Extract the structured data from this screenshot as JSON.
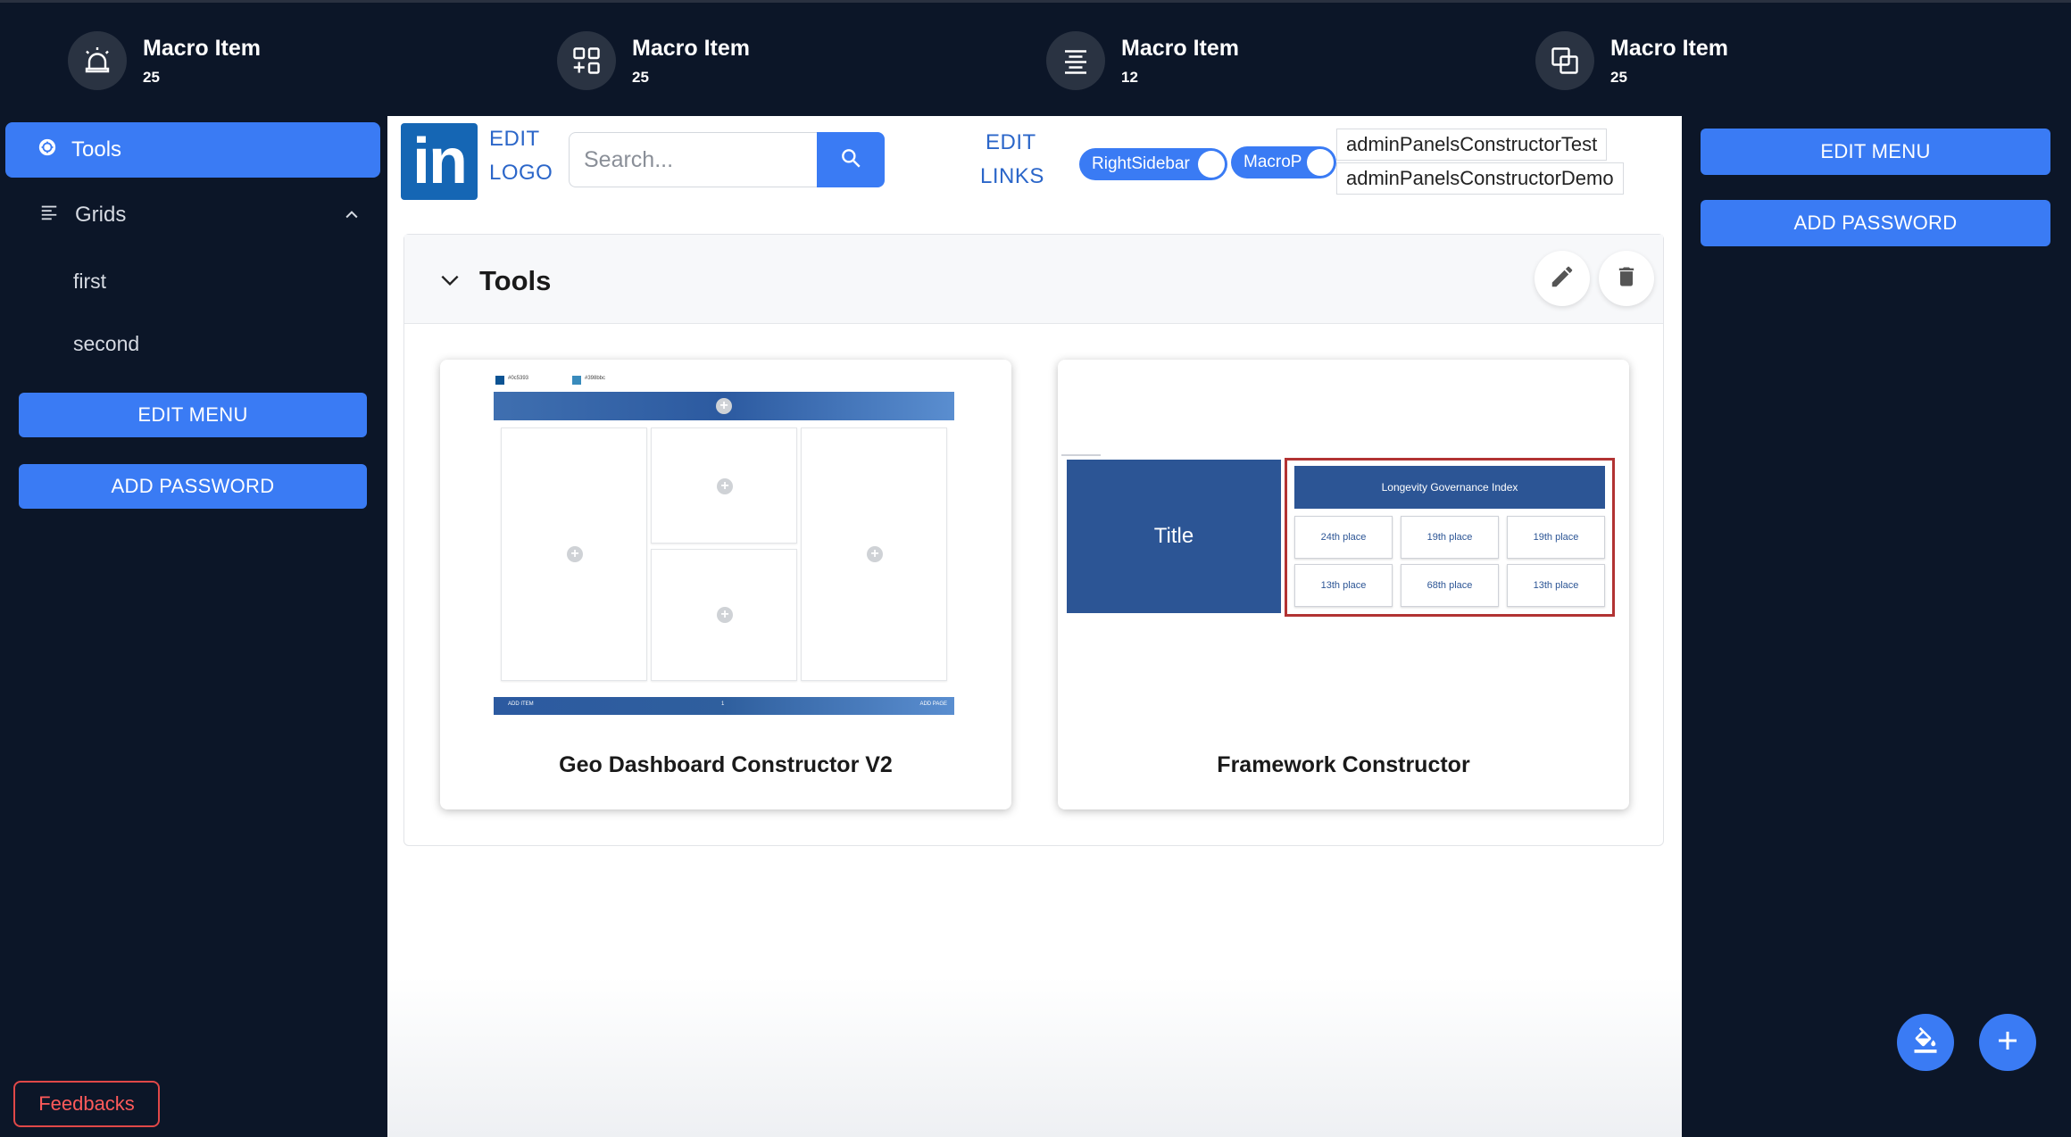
{
  "macro_items": [
    {
      "title": "Macro Item",
      "count": "25",
      "icon": "alarm-icon"
    },
    {
      "title": "Macro Item",
      "count": "25",
      "icon": "apps-add-icon"
    },
    {
      "title": "Macro Item",
      "count": "12",
      "icon": "align-center-icon"
    },
    {
      "title": "Macro Item",
      "count": "25",
      "icon": "layers-icon"
    }
  ],
  "sidebar": {
    "tools_label": "Tools",
    "grids_label": "Grids",
    "sub_items": [
      "first",
      "second"
    ],
    "edit_menu": "EDIT MENU",
    "add_password": "ADD PASSWORD",
    "feedbacks": "Feedbacks"
  },
  "header": {
    "logo_text": "in",
    "edit_logo": [
      "EDIT",
      "LOGO"
    ],
    "search_placeholder": "Search...",
    "edit_links": [
      "EDIT",
      "LINKS"
    ],
    "toggles": [
      "RightSidebar",
      "MacroP"
    ],
    "admin_links": [
      "adminPanelsConstructorTest",
      "adminPanelsConstructorDemo"
    ]
  },
  "section": {
    "title": "Tools",
    "tiles": [
      {
        "name": "Geo Dashboard Constructor V2"
      },
      {
        "name": "Framework Constructor"
      }
    ]
  },
  "thumb1": {
    "legend": [
      "#0c5393",
      "#398bbc"
    ],
    "footer_left": "ADD ITEM",
    "footer_page": "1",
    "footer_right": "ADD PAGE"
  },
  "thumb2": {
    "title": "Title",
    "header": "Longevity Governance Index",
    "cells": [
      "24th place",
      "19th place",
      "19th place",
      "13th place",
      "68th place",
      "13th place"
    ]
  },
  "right_sidebar": {
    "edit_menu": "EDIT MENU",
    "add_password": "ADD PASSWORD"
  },
  "colors": {
    "accent": "#3a7bf4",
    "background": "#0c1628",
    "danger": "#e04848"
  }
}
